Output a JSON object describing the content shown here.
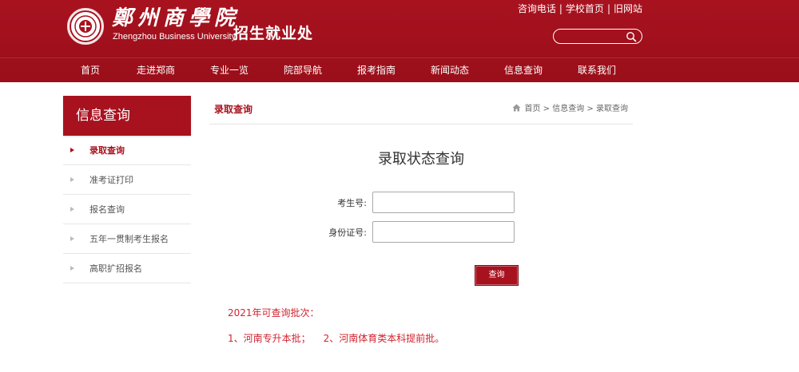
{
  "header": {
    "logo_cn": "鄭州商學院",
    "logo_en": "Zhengzhou Business University",
    "dept": "招生就业处",
    "top_links": [
      "咨询电话",
      "学校首页",
      "旧网站"
    ],
    "search_placeholder": ""
  },
  "nav": [
    "首页",
    "走进郑商",
    "专业一览",
    "院部导航",
    "报考指南",
    "新闻动态",
    "信息查询",
    "联系我们"
  ],
  "sidebar": {
    "title": "信息查询",
    "items": [
      "录取查询",
      "准考证打印",
      "报名查询",
      "五年一贯制考生报名",
      "高职扩招报名"
    ],
    "active_index": 0
  },
  "main": {
    "section_title": "录取查询",
    "breadcrumb": [
      "首页",
      "信息查询",
      "录取查询"
    ],
    "breadcrumb_sep": ">",
    "form_title": "录取状态查询",
    "fields": [
      {
        "label": "考生号:",
        "value": ""
      },
      {
        "label": "身份证号:",
        "value": ""
      }
    ],
    "submit_label": "查询",
    "notice_title": "2021年可查询批次：",
    "notice_items": [
      "1、河南专升本批；",
      "2、河南体育类本科提前批。"
    ]
  },
  "colors": {
    "brand": "#a8121f",
    "notice": "#d0242f"
  }
}
